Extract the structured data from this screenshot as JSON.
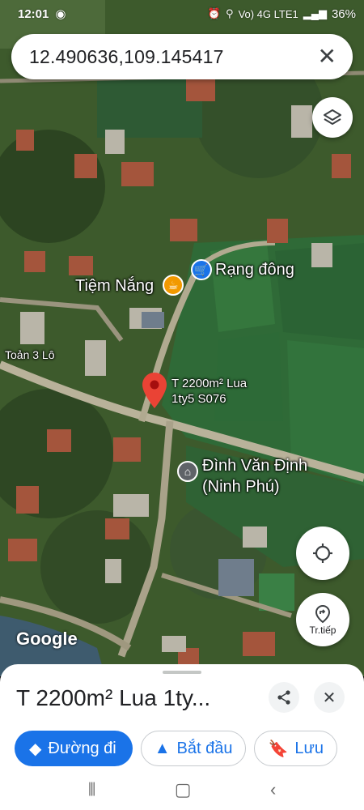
{
  "status_bar": {
    "time": "12:01",
    "network": "Vo) 4G LTE1",
    "battery": "36%"
  },
  "search": {
    "query": "12.490636,109.145417"
  },
  "map": {
    "labels": {
      "rang_dong": "Rạng đông",
      "tiem_nang": "Tiệm Nắng",
      "toan_3_lo": "Toản 3 Lô",
      "pin_line1": "T 2200m² Lua",
      "pin_line2": "1ty5 S076",
      "dinh_line1": "Đình Văn Định",
      "dinh_line2": "(Ninh Phú)",
      "google": "Google"
    },
    "buttons": {
      "directions_next": "Tr.tiếp"
    }
  },
  "sheet": {
    "title": "T 2200m² Lua 1ty...",
    "actions": {
      "directions": "Đường đi",
      "start": "Bắt đầu",
      "save": "Lưu"
    }
  },
  "colors": {
    "accent": "#1a73e8",
    "pin": "#ea4335",
    "shop_poi": "#1a73e8",
    "cafe_poi": "#f29900",
    "landmark_poi": "#5f6368"
  }
}
